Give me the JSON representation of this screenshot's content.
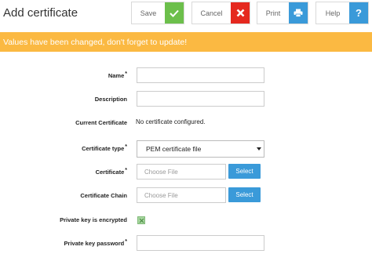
{
  "header": {
    "title": "Add certificate",
    "save_label": "Save",
    "save_icon": "check-icon",
    "cancel_label": "Cancel",
    "cancel_icon": "close-icon",
    "print_label": "Print",
    "print_icon": "printer-icon",
    "help_label": "Help",
    "help_icon": "question-icon",
    "colors": {
      "save": "#6cbf4b",
      "cancel": "#e5291f",
      "print": "#3a9ad9",
      "help": "#3a9ad9"
    }
  },
  "alert": {
    "text": "Values have been changed, don't forget to update!",
    "color": "#fbb942"
  },
  "form": {
    "name": {
      "label": "Name",
      "required_mark": "*",
      "value": ""
    },
    "description": {
      "label": "Description",
      "value": ""
    },
    "current_certificate": {
      "label": "Current Certificate",
      "value": "No certificate configured."
    },
    "certificate_type": {
      "label": "Certificate type",
      "required_mark": "*",
      "selected": "PEM certificate file"
    },
    "certificate": {
      "label": "Certificate",
      "required_mark": "*",
      "placeholder": "Choose File",
      "button_label": "Select"
    },
    "certificate_chain": {
      "label": "Certificate Chain",
      "placeholder": "Choose File",
      "button_label": "Select"
    },
    "private_key_encrypted": {
      "label": "Private key is encrypted",
      "checked": true
    },
    "private_key_password": {
      "label": "Private key password",
      "required_mark": "*",
      "value": ""
    }
  }
}
